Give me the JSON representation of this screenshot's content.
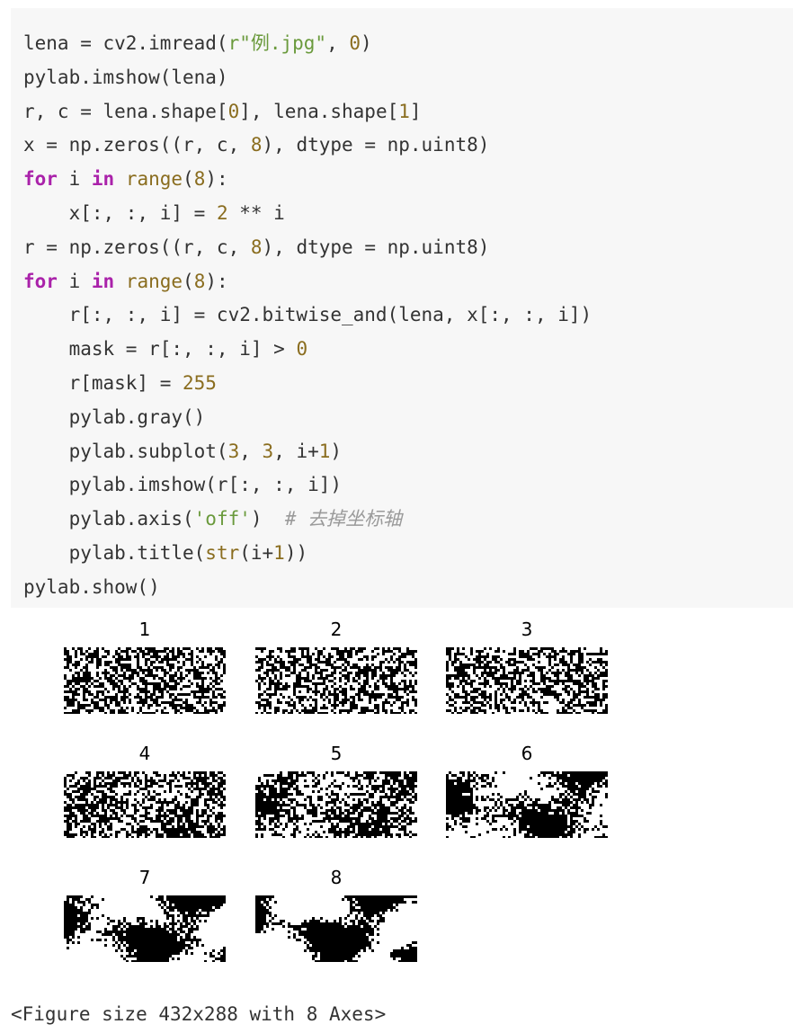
{
  "code_cell": {
    "lines": [
      [
        {
          "t": "lena = cv2.imread(",
          "c": "plain"
        },
        {
          "t": "r\"例.jpg\"",
          "c": "str"
        },
        {
          "t": ", ",
          "c": "plain"
        },
        {
          "t": "0",
          "c": "num"
        },
        {
          "t": ")",
          "c": "plain"
        }
      ],
      [
        {
          "t": "pylab.imshow(lena)",
          "c": "plain"
        }
      ],
      [
        {
          "t": "r, c = lena.shape[",
          "c": "plain"
        },
        {
          "t": "0",
          "c": "num"
        },
        {
          "t": "], lena.shape[",
          "c": "plain"
        },
        {
          "t": "1",
          "c": "num"
        },
        {
          "t": "]",
          "c": "plain"
        }
      ],
      [
        {
          "t": "x = np.zeros((r, c, ",
          "c": "plain"
        },
        {
          "t": "8",
          "c": "num"
        },
        {
          "t": "), dtype = np.uint8)",
          "c": "plain"
        }
      ],
      [
        {
          "t": "for",
          "c": "kw"
        },
        {
          "t": " i ",
          "c": "plain"
        },
        {
          "t": "in",
          "c": "kw"
        },
        {
          "t": " ",
          "c": "plain"
        },
        {
          "t": "range",
          "c": "builtin"
        },
        {
          "t": "(",
          "c": "plain"
        },
        {
          "t": "8",
          "c": "num"
        },
        {
          "t": "):",
          "c": "plain"
        }
      ],
      [
        {
          "t": "    x[:, :, i] = ",
          "c": "plain"
        },
        {
          "t": "2",
          "c": "num"
        },
        {
          "t": " ** i",
          "c": "plain"
        }
      ],
      [
        {
          "t": "r = np.zeros((r, c, ",
          "c": "plain"
        },
        {
          "t": "8",
          "c": "num"
        },
        {
          "t": "), dtype = np.uint8)",
          "c": "plain"
        }
      ],
      [
        {
          "t": "for",
          "c": "kw"
        },
        {
          "t": " i ",
          "c": "plain"
        },
        {
          "t": "in",
          "c": "kw"
        },
        {
          "t": " ",
          "c": "plain"
        },
        {
          "t": "range",
          "c": "builtin"
        },
        {
          "t": "(",
          "c": "plain"
        },
        {
          "t": "8",
          "c": "num"
        },
        {
          "t": "):",
          "c": "plain"
        }
      ],
      [
        {
          "t": "    r[:, :, i] = cv2.bitwise_and(lena, x[:, :, i])",
          "c": "plain"
        }
      ],
      [
        {
          "t": "    mask = r[:, :, i] > ",
          "c": "plain"
        },
        {
          "t": "0",
          "c": "num"
        }
      ],
      [
        {
          "t": "    r[mask] = ",
          "c": "plain"
        },
        {
          "t": "255",
          "c": "num"
        }
      ],
      [
        {
          "t": "    pylab.gray()",
          "c": "plain"
        }
      ],
      [
        {
          "t": "    pylab.subplot(",
          "c": "plain"
        },
        {
          "t": "3",
          "c": "num"
        },
        {
          "t": ", ",
          "c": "plain"
        },
        {
          "t": "3",
          "c": "num"
        },
        {
          "t": ", i+",
          "c": "plain"
        },
        {
          "t": "1",
          "c": "num"
        },
        {
          "t": ")",
          "c": "plain"
        }
      ],
      [
        {
          "t": "    pylab.imshow(r[:, :, i])",
          "c": "plain"
        }
      ],
      [
        {
          "t": "    pylab.axis(",
          "c": "plain"
        },
        {
          "t": "'off'",
          "c": "str"
        },
        {
          "t": ")  ",
          "c": "plain"
        },
        {
          "t": "# 去掉坐标轴",
          "c": "comment"
        }
      ],
      [
        {
          "t": "    pylab.title(",
          "c": "plain"
        },
        {
          "t": "str",
          "c": "builtin"
        },
        {
          "t": "(i+",
          "c": "plain"
        },
        {
          "t": "1",
          "c": "num"
        },
        {
          "t": "))",
          "c": "plain"
        }
      ],
      [
        {
          "t": "pylab.show()",
          "c": "plain"
        }
      ]
    ]
  },
  "figure": {
    "panels": [
      {
        "title": "1"
      },
      {
        "title": "2"
      },
      {
        "title": "3"
      },
      {
        "title": "4"
      },
      {
        "title": "5"
      },
      {
        "title": "6"
      },
      {
        "title": "7"
      },
      {
        "title": "8"
      }
    ]
  },
  "output": {
    "text": "<Figure size 432x288 with 8 Axes>"
  }
}
